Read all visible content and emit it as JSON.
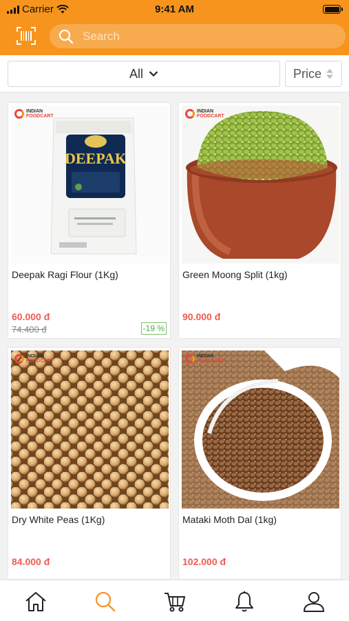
{
  "status_bar": {
    "carrier": "Carrier",
    "time": "9:41 AM"
  },
  "header": {
    "search_placeholder": "Search",
    "accent_color": "#f7941d"
  },
  "filters": {
    "category": "All",
    "sort": "Price"
  },
  "products": [
    {
      "name": "Deepak Ragi Flour (1Kg)",
      "price": "60.000 đ",
      "old_price": "74.400 đ",
      "discount": "-19 %",
      "image": "flour-bag-image",
      "brand_text": [
        "INDIAN",
        "FOODCART"
      ],
      "pack_text": "DEEPAK"
    },
    {
      "name": "Green Moong Split (1kg)",
      "price": "90.000 đ",
      "image": "green-moong-pot-image",
      "brand_text": [
        "INDIAN",
        "FOODCART"
      ]
    },
    {
      "name": "Dry White Peas (1Kg)",
      "price": "84.000 đ",
      "image": "white-peas-image",
      "brand_text": [
        "INDIAN",
        "FOODCART"
      ]
    },
    {
      "name": "Mataki Moth Dal (1kg)",
      "price": "102.000 đ",
      "image": "moth-dal-spoon-image",
      "brand_text": [
        "INDIAN",
        "FOODCART"
      ]
    }
  ],
  "tabs": [
    {
      "icon": "home-icon"
    },
    {
      "icon": "search-icon",
      "active": true
    },
    {
      "icon": "cart-icon"
    },
    {
      "icon": "bell-icon"
    },
    {
      "icon": "profile-icon"
    }
  ],
  "colors": {
    "price": "#f05a50",
    "discount": "#58a94a",
    "active_tab": "#f7941d"
  }
}
